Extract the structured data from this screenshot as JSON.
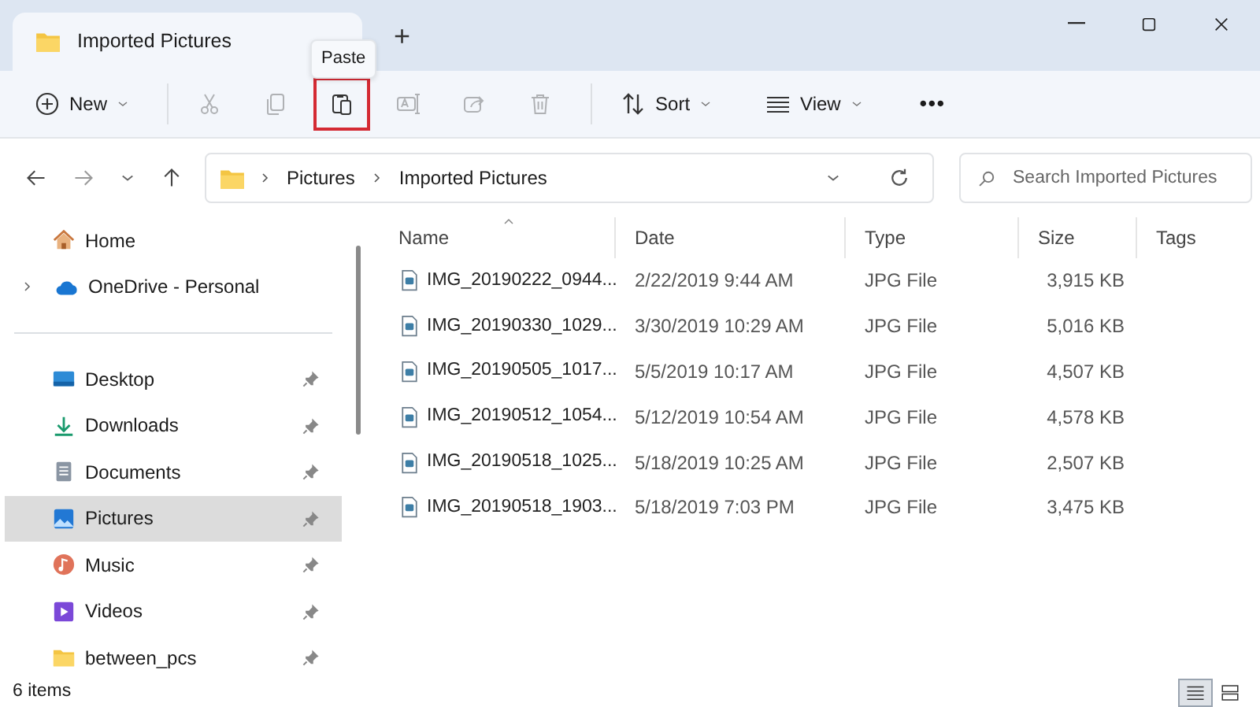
{
  "window": {
    "tab_title": "Imported Pictures",
    "new_tab": "+"
  },
  "toolbar": {
    "items": [
      {
        "kind": "new",
        "label": "New",
        "disabled": false,
        "highlighted": false
      },
      {
        "kind": "cut",
        "disabled": true,
        "highlighted": false
      },
      {
        "kind": "copy",
        "disabled": true,
        "highlighted": false
      },
      {
        "kind": "paste",
        "disabled": false,
        "highlighted": true,
        "tooltip": "Paste"
      },
      {
        "kind": "rename",
        "disabled": true,
        "highlighted": false
      },
      {
        "kind": "share",
        "disabled": true,
        "highlighted": false
      },
      {
        "kind": "delete",
        "disabled": true,
        "highlighted": false
      },
      {
        "kind": "sort",
        "label": "Sort",
        "disabled": false,
        "highlighted": false
      },
      {
        "kind": "view",
        "label": "View",
        "disabled": false,
        "highlighted": false
      },
      {
        "kind": "more",
        "label": "•••",
        "disabled": false,
        "highlighted": false
      }
    ]
  },
  "address_bar": {
    "path": [
      "Pictures",
      "Imported Pictures"
    ]
  },
  "search": {
    "placeholder": "Search Imported Pictures"
  },
  "sidebar": {
    "items": [
      {
        "kind": "home",
        "label": "Home",
        "pinned": false,
        "expandable": false,
        "selected": false
      },
      {
        "kind": "cloud",
        "label": "OneDrive - Personal",
        "pinned": false,
        "expandable": true,
        "selected": false
      },
      {
        "kind": "desktop",
        "label": "Desktop",
        "pinned": true,
        "expandable": false,
        "selected": false
      },
      {
        "kind": "downloads",
        "label": "Downloads",
        "pinned": true,
        "expandable": false,
        "selected": false
      },
      {
        "kind": "documents",
        "label": "Documents",
        "pinned": true,
        "expandable": false,
        "selected": false
      },
      {
        "kind": "pictures",
        "label": "Pictures",
        "pinned": true,
        "expandable": false,
        "selected": true
      },
      {
        "kind": "music",
        "label": "Music",
        "pinned": true,
        "expandable": false,
        "selected": false
      },
      {
        "kind": "videos",
        "label": "Videos",
        "pinned": true,
        "expandable": false,
        "selected": false
      },
      {
        "kind": "folder",
        "label": "between_pcs",
        "pinned": true,
        "expandable": false,
        "selected": false
      }
    ]
  },
  "table": {
    "columns": [
      "Name",
      "Date",
      "Type",
      "Size",
      "Tags"
    ],
    "rows": [
      [
        "IMG_20190222_0944...",
        "2/22/2019 9:44 AM",
        "JPG File",
        "3,915 KB"
      ],
      [
        "IMG_20190330_1029...",
        "3/30/2019 10:29 AM",
        "JPG File",
        "5,016 KB"
      ],
      [
        "IMG_20190505_1017...",
        "5/5/2019 10:17 AM",
        "JPG File",
        "4,507 KB"
      ],
      [
        "IMG_20190512_1054...",
        "5/12/2019 10:54 AM",
        "JPG File",
        "4,578 KB"
      ],
      [
        "IMG_20190518_1025...",
        "5/18/2019 10:25 AM",
        "JPG File",
        "2,507 KB"
      ],
      [
        "IMG_20190518_1903...",
        "5/18/2019 7:03 PM",
        "JPG File",
        "3,475 KB"
      ]
    ]
  },
  "status_bar": {
    "count": "6 items",
    "views": [
      {
        "kind": "details",
        "selected": true
      },
      {
        "kind": "tiles",
        "selected": false
      }
    ]
  }
}
